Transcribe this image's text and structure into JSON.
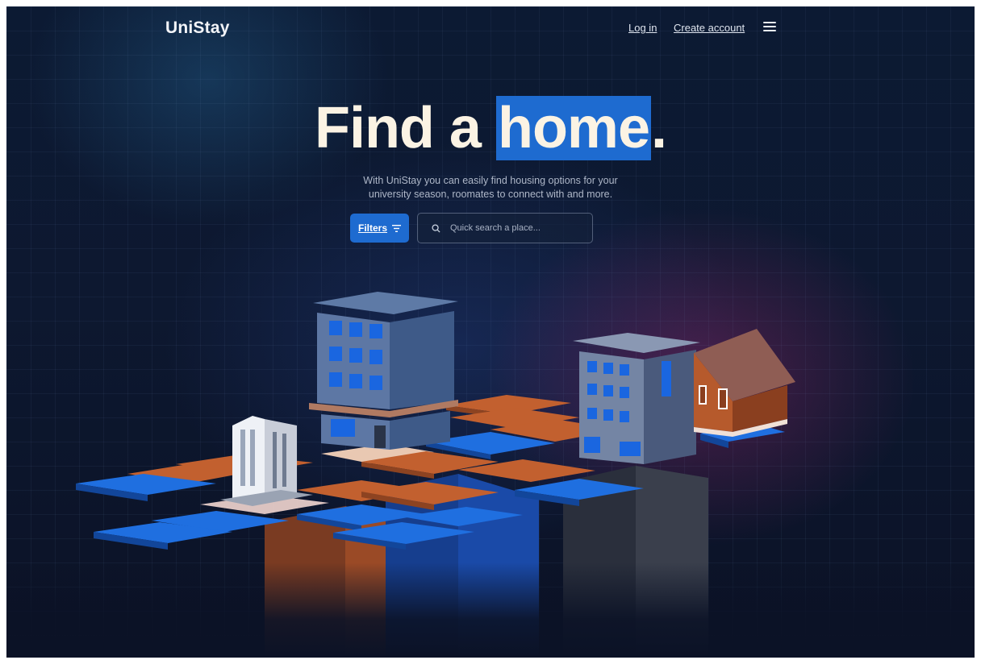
{
  "nav": {
    "logo": "UniStay",
    "login_label": "Log in",
    "create_account_label": "Create account",
    "menu_icon": "hamburger-menu-icon"
  },
  "hero": {
    "title_before": "Find a ",
    "title_highlight": "home",
    "title_after": ".",
    "subtitle_line1": "With UniStay you can easily find housing options for your",
    "subtitle_line2": "university season, roomates to connect with and more."
  },
  "search": {
    "filters_label": "Filters",
    "filters_icon": "filter-icon",
    "search_icon": "search-icon",
    "placeholder": "Quick search a place..."
  },
  "colors": {
    "background": "#0c1a33",
    "accent": "#1e6bd0",
    "title_text": "#fbf3e4",
    "tile_blue": "#1f6fe0",
    "tile_orange": "#c2602f"
  }
}
